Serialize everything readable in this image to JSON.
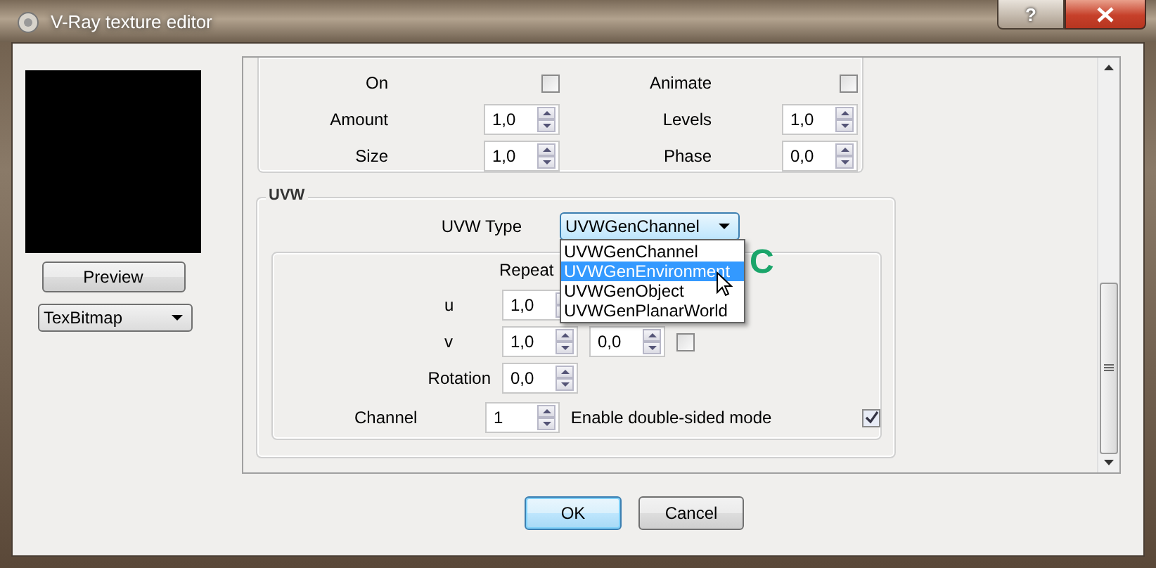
{
  "window": {
    "title": "V-Ray texture editor",
    "help_button": "?"
  },
  "preview": {
    "button": "Preview",
    "texture_type": "TexBitmap"
  },
  "uv_noise": {
    "fields": [
      {
        "label": "On",
        "kind": "checkbox",
        "checked": false
      },
      {
        "label": "Animate",
        "kind": "checkbox",
        "checked": false
      },
      {
        "label": "Amount",
        "kind": "spinner",
        "value": "1,0"
      },
      {
        "label": "Levels",
        "kind": "spinner",
        "value": "1,0"
      },
      {
        "label": "Size",
        "kind": "spinner",
        "value": "1,0"
      },
      {
        "label": "Phase",
        "kind": "spinner",
        "value": "0,0"
      }
    ]
  },
  "uvw": {
    "title": "UVW",
    "type_label": "UVW Type",
    "type_value": "UVWGenChannel",
    "type_options": [
      {
        "label": "UVWGenChannel",
        "selected": false
      },
      {
        "label": "UVWGenEnvironment",
        "selected": true
      },
      {
        "label": "UVWGenObject",
        "selected": false
      },
      {
        "label": "UVWGenPlanarWorld",
        "selected": false
      }
    ],
    "repeat_label": "Repeat",
    "u_label": "u",
    "u_value": "1,0",
    "v_label": "v",
    "v_values": [
      "1,0",
      "0,0"
    ],
    "v_checked": false,
    "rotation_label": "Rotation",
    "rotation_value": "0,0",
    "channel_label": "Channel",
    "channel_value": "1",
    "double_sided_label": "Enable double-sided mode",
    "double_sided_checked": true
  },
  "annotation": "C",
  "buttons": [
    {
      "label": "OK",
      "focused": true
    },
    {
      "label": "Cancel",
      "focused": false
    }
  ]
}
